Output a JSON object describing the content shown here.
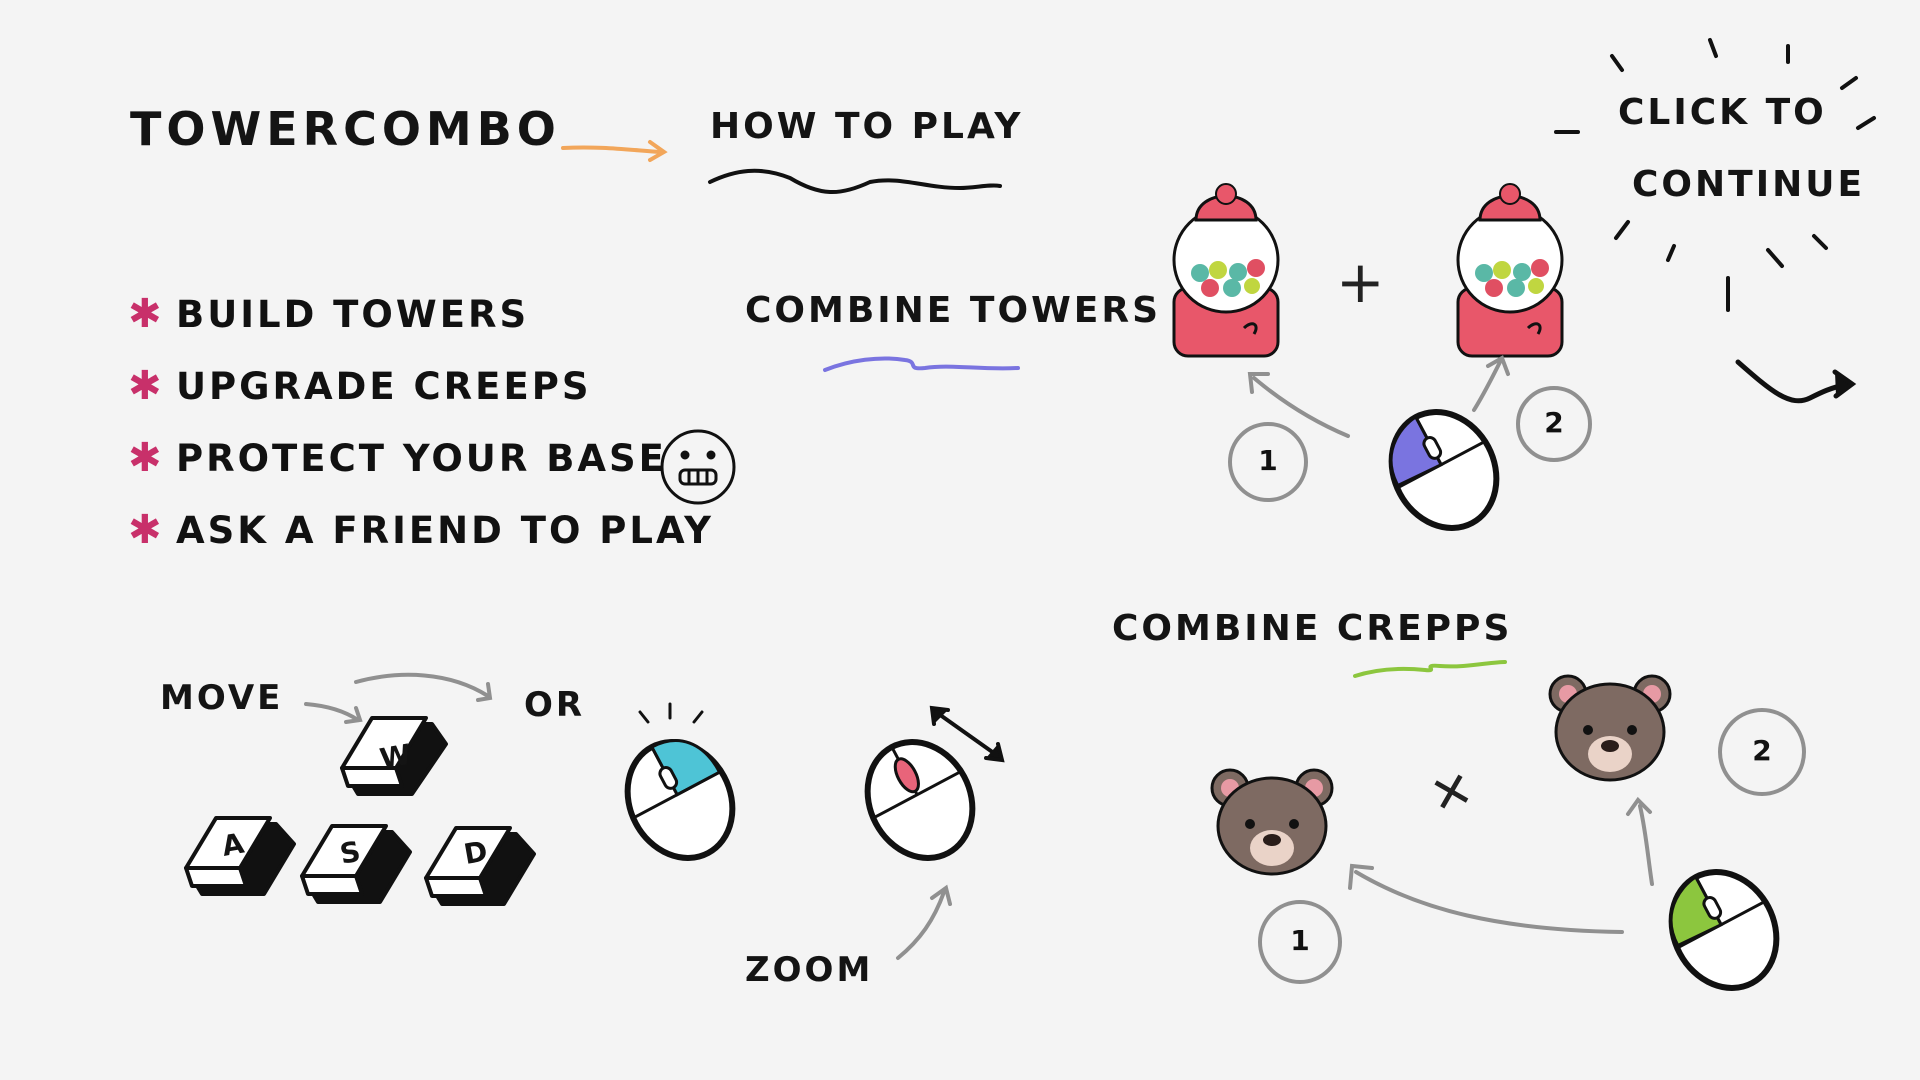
{
  "game": {
    "title": "TOWERCOMBO",
    "how_to_play": "HOW TO PLAY"
  },
  "rules": [
    {
      "label": "BUILD TOWERS"
    },
    {
      "label": "UPGRADE CREEPS"
    },
    {
      "label": "PROTECT YOUR BASE"
    },
    {
      "label": "ASK A FRIEND TO PLAY"
    }
  ],
  "bullet_glyph": "✱",
  "combine_towers": {
    "label": "COMBINE TOWERS",
    "plus": "+",
    "step_1": "1",
    "step_2": "2",
    "tower_icon": "gumball-machine-icon",
    "mouse_icon": "mouse-left-click-icon",
    "accent": "#7a74e0"
  },
  "combine_creeps": {
    "label": "COMBINE CREPPS",
    "plus": "+",
    "step_1": "1",
    "step_2": "2",
    "creep_icon": "teddy-bear-icon",
    "mouse_icon": "mouse-left-click-icon",
    "accent": "#8cc63e"
  },
  "controls": {
    "move_label": "MOVE",
    "or_label": "OR",
    "zoom_label": "ZOOM",
    "keys": [
      "W",
      "A",
      "S",
      "D"
    ],
    "pan_mouse_icon": "mouse-left-drag-icon",
    "zoom_mouse_icon": "mouse-scroll-wheel-icon",
    "pan_accent": "#4ec4d6",
    "zoom_accent": "#e8647a"
  },
  "continue": {
    "line1": "CLICK TO",
    "line2": "CONTINUE"
  },
  "colors": {
    "title_arrow": "#f2a65a",
    "bullet": "#c8306a",
    "tower_body": "#e8576a",
    "bear_fur": "#7e6a62",
    "arrow_gray": "#909090"
  },
  "face_icon": "grimace-face-icon"
}
